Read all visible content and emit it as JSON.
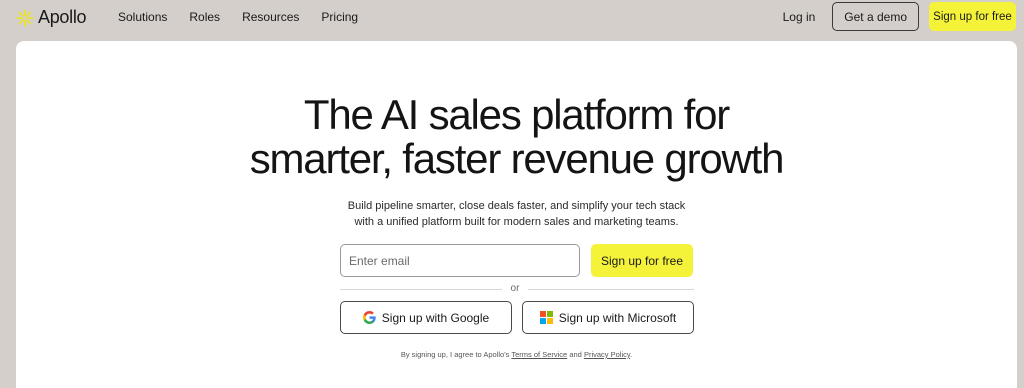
{
  "brand": {
    "name": "Apollo",
    "accent": "#f4f33a",
    "logo_icon": "asterisk-flower-icon"
  },
  "nav": {
    "links": [
      "Solutions",
      "Roles",
      "Resources",
      "Pricing"
    ],
    "login": "Log in",
    "demo": "Get a demo",
    "signup": "Sign up for free"
  },
  "hero": {
    "headline_line1": "The AI sales platform for",
    "headline_line2": "smarter, faster revenue growth",
    "subtitle_line1": "Build pipeline smarter, close deals faster, and simplify your tech stack",
    "subtitle_line2": "with a unified platform built for modern sales and marketing teams."
  },
  "form": {
    "email_placeholder": "Enter email",
    "signup_label": "Sign up for free",
    "or": "or",
    "google_label": "Sign up with Google",
    "microsoft_label": "Sign up with Microsoft"
  },
  "legal": {
    "prefix": "By signing up, I agree to Apollo's",
    "terms": "Terms of Service",
    "and": "and",
    "privacy": "Privacy Policy",
    "suffix": "."
  }
}
